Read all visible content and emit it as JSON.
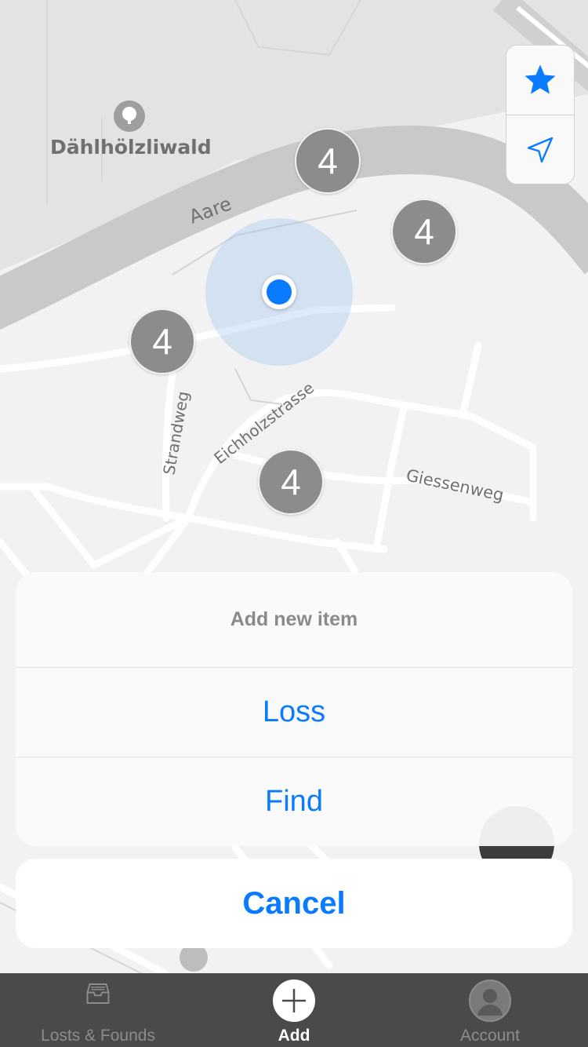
{
  "map": {
    "labels": {
      "forest": "Dählhölzliwald",
      "river": "Aare",
      "street_1": "Eichholzstrasse",
      "street_2": "Strandweg",
      "street_3": "Giessenweg"
    },
    "clusters": [
      {
        "count": "4"
      },
      {
        "count": "4"
      },
      {
        "count": "4"
      },
      {
        "count": "4"
      }
    ]
  },
  "map_controls": {
    "favorites_icon": "star-icon",
    "locate_icon": "location-arrow-icon"
  },
  "action_sheet": {
    "title": "Add new item",
    "actions": [
      {
        "label": "Loss"
      },
      {
        "label": "Find"
      }
    ],
    "cancel_label": "Cancel"
  },
  "tabbar": {
    "tabs": [
      {
        "label": "Losts & Founds",
        "icon": "inbox-icon",
        "active": false
      },
      {
        "label": "Add",
        "icon": "plus-icon",
        "active": true
      },
      {
        "label": "Account",
        "icon": "person-icon",
        "active": false
      }
    ]
  },
  "colors": {
    "accent": "#0a7aff",
    "cluster": "#8c8c8c",
    "tabbar": "#4a4a4a"
  }
}
